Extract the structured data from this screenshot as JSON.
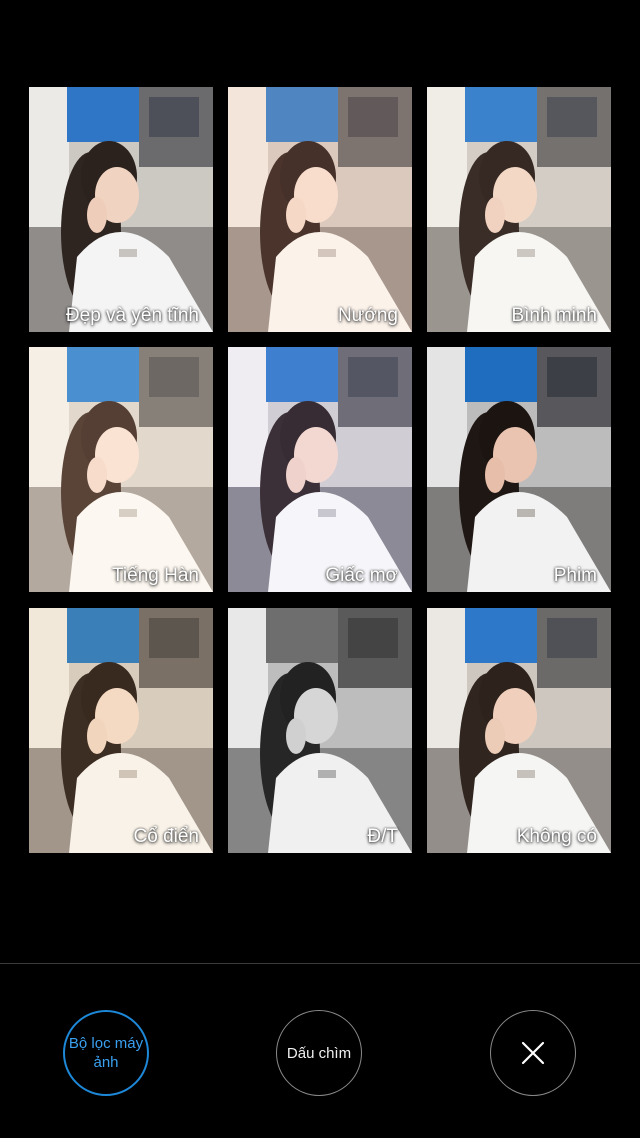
{
  "filters": [
    {
      "label": "Đẹp và yên tĩnh"
    },
    {
      "label": "Nướng"
    },
    {
      "label": "Bình minh"
    },
    {
      "label": "Tiếng Hàn"
    },
    {
      "label": "Giấc mơ"
    },
    {
      "label": "Phim"
    },
    {
      "label": "Cổ điển"
    },
    {
      "label": "Đ/T"
    },
    {
      "label": "Không có"
    }
  ],
  "bottom_bar": {
    "camera_filters_label": "Bộ lọc máy ảnh",
    "watermark_label": "Dấu chìm",
    "close_icon": "close-icon"
  },
  "colors": {
    "background": "#000000",
    "accent": "#1e88d8",
    "button_border": "#8a8a8a"
  }
}
